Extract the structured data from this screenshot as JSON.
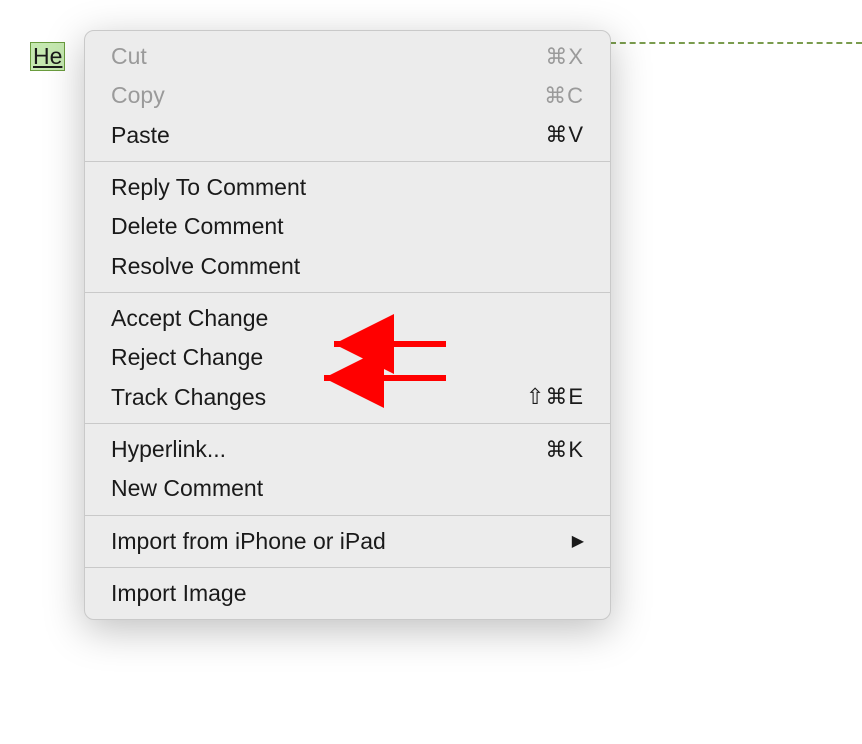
{
  "highlight": {
    "text": "He"
  },
  "menu": {
    "sections": [
      [
        {
          "label": "Cut",
          "shortcut": "⌘X",
          "disabled": true
        },
        {
          "label": "Copy",
          "shortcut": "⌘C",
          "disabled": true
        },
        {
          "label": "Paste",
          "shortcut": "⌘V",
          "disabled": false
        }
      ],
      [
        {
          "label": "Reply To Comment",
          "disabled": false
        },
        {
          "label": "Delete Comment",
          "disabled": false
        },
        {
          "label": "Resolve Comment",
          "disabled": false
        }
      ],
      [
        {
          "label": "Accept Change",
          "disabled": false
        },
        {
          "label": "Reject Change",
          "disabled": false
        },
        {
          "label": "Track Changes",
          "shortcut": "⇧⌘E",
          "disabled": false
        }
      ],
      [
        {
          "label": "Hyperlink...",
          "shortcut": "⌘K",
          "disabled": false
        },
        {
          "label": "New Comment",
          "disabled": false
        }
      ],
      [
        {
          "label": "Import from iPhone or iPad",
          "submenu": true,
          "disabled": false
        }
      ],
      [
        {
          "label": "Import Image",
          "disabled": false
        }
      ]
    ]
  }
}
